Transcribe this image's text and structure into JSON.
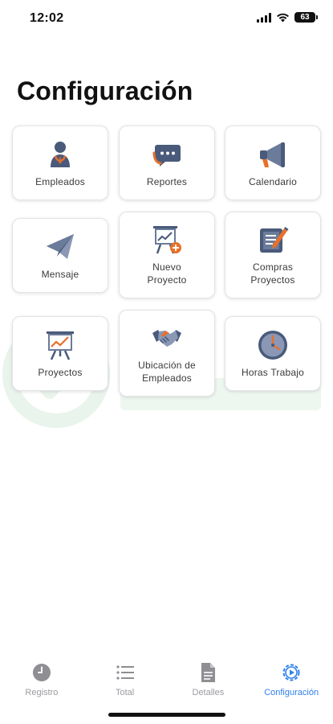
{
  "status": {
    "time": "12:02",
    "battery": "63"
  },
  "page": {
    "title": "Configuración"
  },
  "tiles": [
    {
      "label": "Empleados",
      "icon": "employee-icon"
    },
    {
      "label": "Reportes",
      "icon": "chat-bubbles-icon"
    },
    {
      "label": "Calendario",
      "icon": "megaphone-icon"
    },
    {
      "label": "Mensaje",
      "icon": "paper-plane-icon"
    },
    {
      "label": "Nuevo Proyecto",
      "line1": "Nuevo",
      "line2": "Proyecto",
      "icon": "presentation-add-icon"
    },
    {
      "label": "Compras Proyectos",
      "line1": "Compras",
      "line2": "Proyectos",
      "icon": "notepad-pencil-icon"
    },
    {
      "label": "Proyectos",
      "icon": "presentation-chart-icon"
    },
    {
      "label": "Ubicación de Empleados",
      "line1": "Ubicación de",
      "line2": "Empleados",
      "icon": "handshake-icon"
    },
    {
      "label": "Horas Trabajo",
      "icon": "clock-icon"
    }
  ],
  "tabs": [
    {
      "label": "Registro",
      "icon": "clock-filled-icon",
      "active": false
    },
    {
      "label": "Total",
      "icon": "list-icon",
      "active": false
    },
    {
      "label": "Detalles",
      "icon": "document-icon",
      "active": false
    },
    {
      "label": "Configuración",
      "icon": "gear-play-icon",
      "active": true
    }
  ],
  "colors": {
    "accent": "#2f80ed",
    "icon_fill": "#4a5a7a",
    "icon_accent": "#e8702a",
    "inactive": "#9a9aa0"
  }
}
